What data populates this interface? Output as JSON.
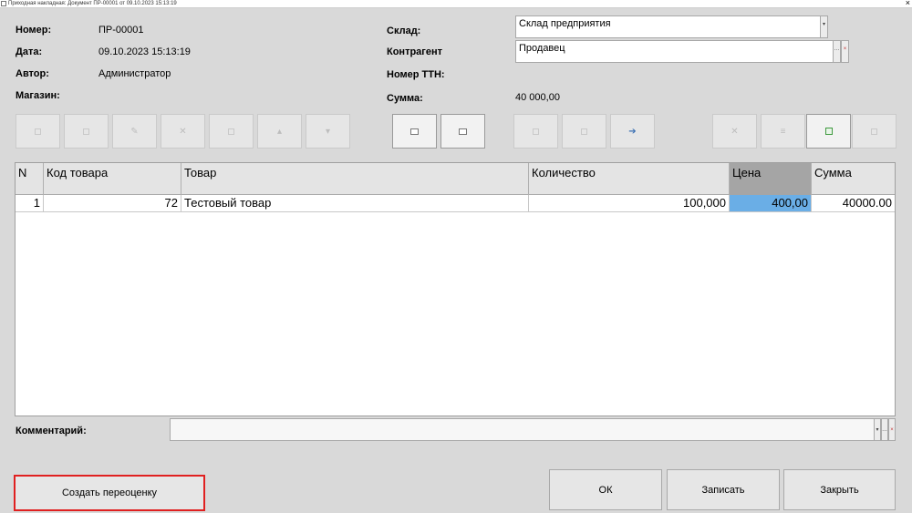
{
  "window": {
    "title": "Приходная накладная: Документ ПР-00001 от 09.10.2023 15:13:19",
    "close": "×"
  },
  "header": {
    "number_label": "Номер:",
    "number_value": "ПР-00001",
    "date_label": "Дата:",
    "date_value": "09.10.2023 15:13:19",
    "author_label": "Автор:",
    "author_value": "Администратор",
    "shop_label": "Магазин:",
    "warehouse_label": "Склад:",
    "warehouse_value": "Склад предприятия",
    "counterparty_label": "Контрагент",
    "counterparty_value": "Продавец",
    "ttn_label": "Номер ТТН:",
    "sum_label": "Сумма:",
    "sum_value": "40 000,00"
  },
  "toolbar": {
    "icons": [
      "add-icon",
      "copy-icon",
      "edit-icon",
      "delete-icon",
      "save-icon",
      "move-up-icon",
      "move-down-icon",
      "print-icon",
      "print-preview-icon",
      "fill-icon",
      "select-icon",
      "arrow-icon",
      "clear-icon",
      "list-icon",
      "document-green-icon",
      "export-icon"
    ]
  },
  "table": {
    "columns": [
      "N",
      "Код товара",
      "Товар",
      "Количество",
      "Цена",
      "Сумма"
    ],
    "rows": [
      {
        "n": "1",
        "code": "72",
        "product": "Тестовый товар",
        "qty": "100,000",
        "price": "400,00",
        "sum": "40000.00"
      }
    ]
  },
  "footer": {
    "comment_label": "Комментарий:",
    "comment_value": "",
    "create_reprice_button": "Создать переоценку",
    "ok_button": "ОК",
    "save_button": "Записать",
    "close_button": "Закрыть"
  },
  "colors": {
    "background": "#d9d9d9",
    "selection": "#6aaee6",
    "highlight_border": "#e02020"
  }
}
